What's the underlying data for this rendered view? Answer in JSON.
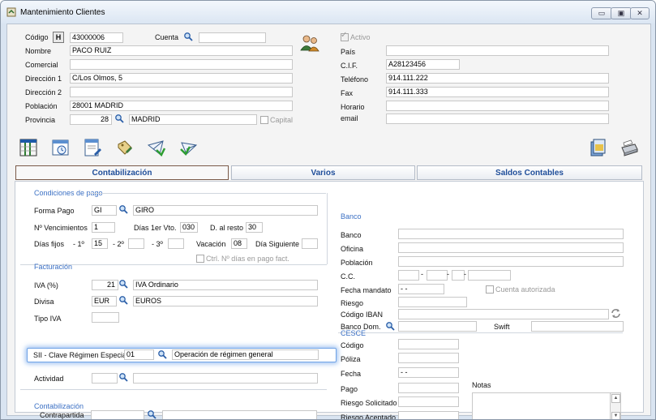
{
  "window": {
    "title": "Mantenimiento Clientes",
    "minimize": "▭",
    "maximize": "▣",
    "close": "✕"
  },
  "header": {
    "codigo_label": "Código",
    "h_button": "H",
    "codigo_value": "43000006",
    "cuenta_label": "Cuenta",
    "cuenta_value": "",
    "nombre_label": "Nombre",
    "nombre_value": "PACO RUIZ",
    "comercial_label": "Comercial",
    "comercial_value": "",
    "direccion1_label": "Dirección  1",
    "direccion1_value": "C/Los Olmos, 5",
    "direccion2_label": "Dirección  2",
    "direccion2_value": "",
    "poblacion_label": "Población",
    "poblacion_value": "28001 MADRID",
    "provincia_label": "Provincia",
    "provincia_code": "28",
    "provincia_name": "MADRID",
    "capital_label": "Capital",
    "activo_label": "Activo",
    "pais_label": "País",
    "pais_value": "",
    "cif_label": "C.I.F.",
    "cif_value": "A28123456",
    "telefono_label": "Teléfono",
    "telefono_value": "914.111.222",
    "fax_label": "Fax",
    "fax_value": "914.111.333",
    "horario_label": "Horario",
    "horario_value": "",
    "email_label": "email",
    "email_value": ""
  },
  "tabs": [
    {
      "label": "Contabilización"
    },
    {
      "label": "Varios"
    },
    {
      "label": "Saldos Contables"
    }
  ],
  "condiciones": {
    "title": "Condiciones de pago",
    "forma_pago_label": "Forma Pago",
    "forma_pago_code": "GI",
    "forma_pago_name": "GIRO",
    "vencimientos_label": "Nº Vencimientos",
    "vencimientos_value": "1",
    "dias1_label": "Días 1er Vto.",
    "dias1_value": "030",
    "dalresto_label": "D. al resto",
    "dalresto_value": "30",
    "dias_fijos_label": "Días fijos",
    "fijo1_label": "- 1º",
    "fijo1_value": "15",
    "fijo2_label": "- 2º",
    "fijo2_value": "",
    "fijo3_label": "- 3º",
    "fijo3_value": "",
    "vacacion_label": "Vacación",
    "vacacion_value": "08",
    "dia_siguiente_label": "Día Siguiente",
    "dia_siguiente_value": "",
    "ctrl_label": "Ctrl. Nº días en pago fact."
  },
  "facturacion": {
    "title": "Facturación",
    "iva_label": "IVA (%)",
    "iva_value": "21",
    "iva_name": "IVA Ordinario",
    "divisa_label": "Divisa",
    "divisa_code": "EUR",
    "divisa_name": "EUROS",
    "tipo_iva_label": "Tipo IVA",
    "tipo_iva_value": "",
    "sii_label": "SII - Clave Régimen Especial",
    "sii_code": "01",
    "sii_name": "Operación de régimen general",
    "actividad_label": "Actividad",
    "actividad_code": "",
    "actividad_name": ""
  },
  "contabilizacion": {
    "title": "Contabilización",
    "contrapartida_label": "Contrapartida",
    "contrapartida_code": "",
    "contrapartida_name": ""
  },
  "banco": {
    "title": "Banco",
    "banco_label": "Banco",
    "oficina_label": "Oficina",
    "poblacion_label": "Población",
    "cc_label": "C.C.",
    "fecha_mandato_label": "Fecha mandato",
    "fecha_mandato_value": "- -",
    "cuenta_autorizada_label": "Cuenta autorizada",
    "riesgo_label": "Riesgo",
    "iban_label": "Código IBAN",
    "banco_dom_label": "Banco Dom.",
    "swift_label": "Swift"
  },
  "cesce": {
    "title": "CESCE",
    "codigo_label": "Código",
    "poliza_label": "Póliza",
    "fecha_label": "Fecha",
    "fecha_value": "- -",
    "pago_label": "Pago",
    "riesgo_solicitado_label": "Riesgo Solicitado",
    "riesgo_aceptado_label": "Riesgo Aceptado",
    "notas_label": "Notas"
  },
  "colors": {
    "section_title": "#3b70c4",
    "tab_text": "#1f4e9a",
    "highlight": "#6fa3e6"
  }
}
